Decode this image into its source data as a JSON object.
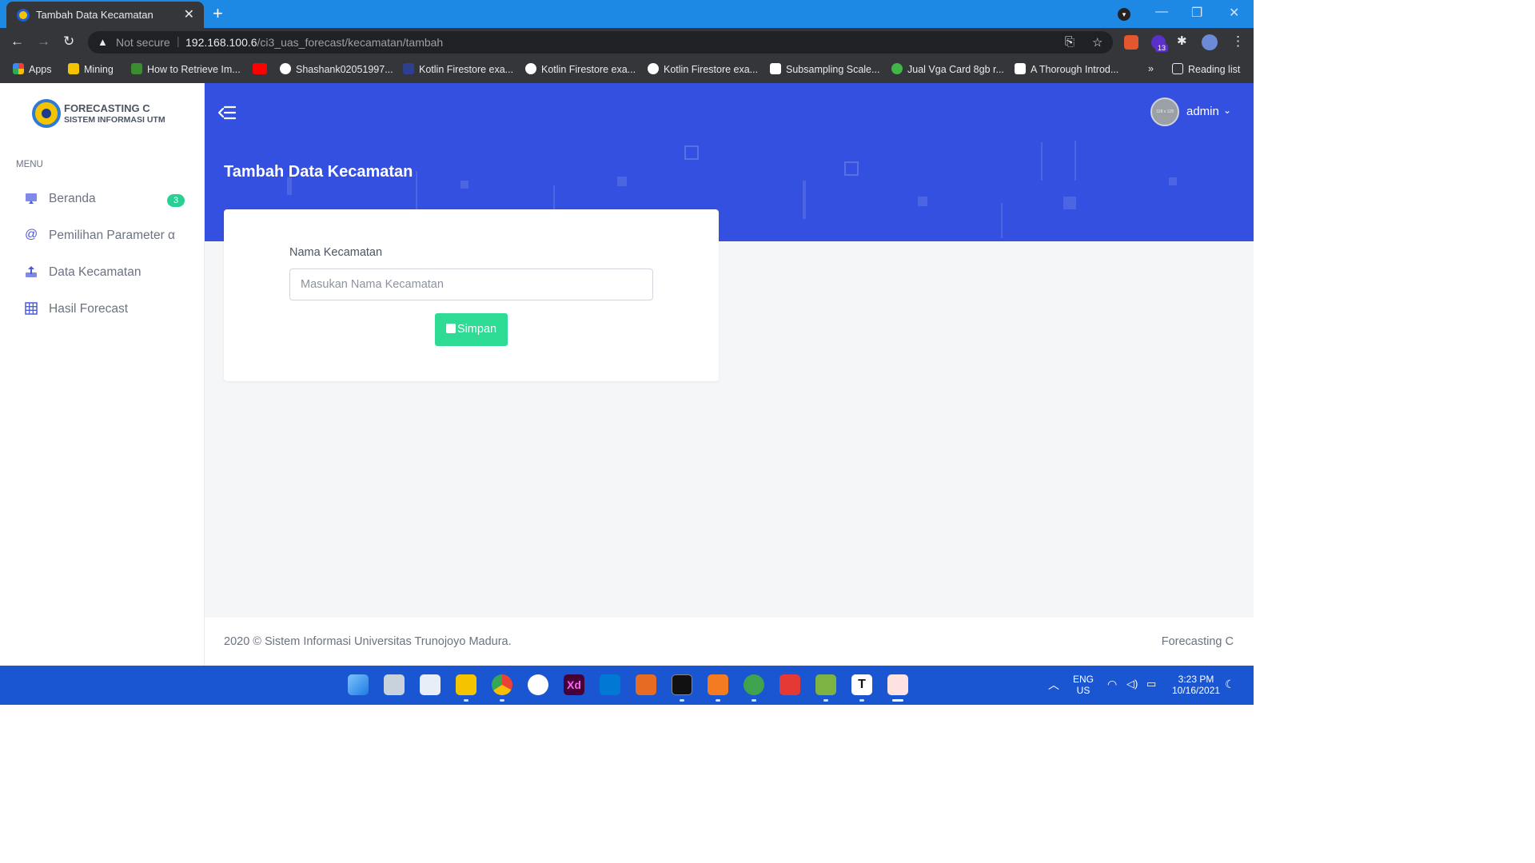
{
  "browser": {
    "tab_title": "Tambah Data Kecamatan",
    "not_secure": "Not secure",
    "url_host": "192.168.100.6",
    "url_path": "/ci3_uas_forecast/kecamatan/tambah",
    "extension_badge": "13",
    "bookmarks": [
      {
        "label": "Apps",
        "color": "#ea4335"
      },
      {
        "label": "Mining",
        "color": "#f4c400"
      },
      {
        "label": "How to Retrieve Im...",
        "color": "#3c8d2f"
      },
      {
        "label": "",
        "color": "#ff0000"
      },
      {
        "label": "Shashank02051997...",
        "color": "#ffffff"
      },
      {
        "label": "Kotlin Firestore exa...",
        "color": "#2f3f8f"
      },
      {
        "label": "Kotlin Firestore exa...",
        "color": "#ffffff"
      },
      {
        "label": "Kotlin Firestore exa...",
        "color": "#ffffff"
      },
      {
        "label": "Subsampling Scale...",
        "color": "#ffffff"
      },
      {
        "label": "Jual Vga Card 8gb r...",
        "color": "#42b549"
      },
      {
        "label": "A Thorough Introd...",
        "color": "#000000"
      }
    ],
    "more_bookmarks": "»",
    "reading_list": "Reading list"
  },
  "sidebar": {
    "brand_line1": "FORECASTING C",
    "brand_line2": "SISTEM INFORMASI UTM",
    "menu_header": "MENU",
    "items": [
      {
        "label": "Beranda",
        "icon": "monitor-icon",
        "badge": "3"
      },
      {
        "label": "Pemilihan Parameter α",
        "icon": "at-icon"
      },
      {
        "label": "Data Kecamatan",
        "icon": "upload-icon"
      },
      {
        "label": "Hasil Forecast",
        "icon": "grid-icon"
      }
    ]
  },
  "header": {
    "page_title": "Tambah Data Kecamatan",
    "avatar_text": "128 x 128",
    "user_name": "admin"
  },
  "form": {
    "label": "Nama Kecamatan",
    "placeholder": "Masukan Nama Kecamatan",
    "value": "",
    "submit_label": "Simpan"
  },
  "footer": {
    "left": "2020 © Sistem Informasi Universitas Trunojoyo Madura.",
    "right": "Forecasting C"
  },
  "taskbar": {
    "lang1": "ENG",
    "lang2": "US",
    "time": "3:23 PM",
    "date": "10/16/2021"
  },
  "colors": {
    "primary_header": "#3450e0",
    "success_button": "#2edb95",
    "badge_green": "#28d094",
    "taskbar": "#1a56d1",
    "browser_frame": "#1e88e5"
  }
}
